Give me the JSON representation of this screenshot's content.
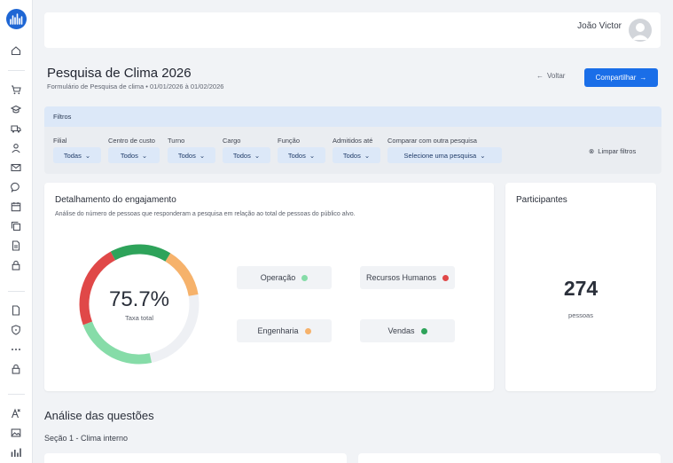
{
  "user": {
    "name": "João Victor"
  },
  "page": {
    "title": "Pesquisa de Clima 2026",
    "subtitle": "Formulário de Pesquisa de clima  •  01/01/2026 à 01/02/2026",
    "back_label": "Voltar",
    "share_label": "Compartilhar"
  },
  "filters": {
    "header": "Filtros",
    "items": [
      {
        "label": "Filial",
        "value": "Todas"
      },
      {
        "label": "Centro de custo",
        "value": "Todos"
      },
      {
        "label": "Turno",
        "value": "Todos"
      },
      {
        "label": "Cargo",
        "value": "Todos"
      },
      {
        "label": "Função",
        "value": "Todos"
      },
      {
        "label": "Admitidos até",
        "value": "Todos"
      },
      {
        "label": "Comparar com outra pesquisa",
        "value": "Selecione uma pesquisa"
      }
    ],
    "clear_label": "Limpar filtros"
  },
  "engagement": {
    "title": "Detalhamento do engajamento",
    "description": "Análise do número de pessoas que responderam a pesquisa em relação ao total de pessoas do público alvo.",
    "rate": "75.7%",
    "rate_value": 75.7,
    "rate_caption": "Taxa total",
    "segments": [
      {
        "name": "Operação",
        "color": "#86dca8"
      },
      {
        "name": "Recursos Humanos",
        "color": "#e04848"
      },
      {
        "name": "Engenharia",
        "color": "#f6b26b"
      },
      {
        "name": "Vendas",
        "color": "#2ea35a"
      }
    ],
    "track_color": "#eef0f4"
  },
  "participants": {
    "title": "Participantes",
    "value": "274",
    "caption": "pessoas"
  },
  "analysis": {
    "heading": "Análise das questões",
    "section": "Seção 1 - Clima interno"
  },
  "sidebar": {
    "icons": [
      "home-icon",
      "cart-icon",
      "graduation-cap-icon",
      "truck-icon",
      "user-icon",
      "mail-icon",
      "chat-icon",
      "calendar-icon",
      "copy-icon",
      "document-icon",
      "lock-icon",
      "file-icon",
      "shield-icon",
      "more-icon",
      "lock-icon",
      "translate-icon",
      "image-icon",
      "chart-icon"
    ]
  },
  "colors": {
    "primary": "#1a6ee8",
    "filter_header": "#dce8f8"
  }
}
